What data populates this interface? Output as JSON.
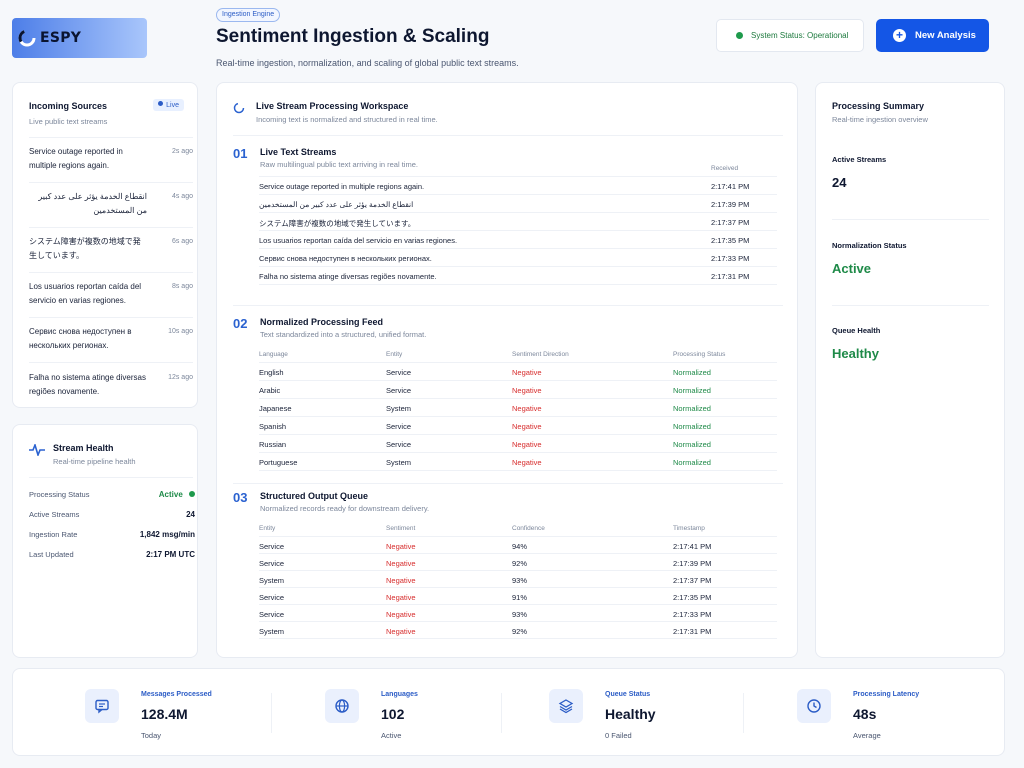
{
  "brand": {
    "name": "ESPY"
  },
  "header": {
    "tag": "Ingestion Engine",
    "title": "Sentiment Ingestion & Scaling",
    "subtitle": "Real-time ingestion, normalization, and scaling of global public text streams.",
    "status": "System Status: Operational",
    "new_button": "New Analysis"
  },
  "sources": {
    "title": "Incoming Sources",
    "subtitle": "Live public text streams",
    "badge": "Live",
    "items": [
      {
        "text": "Service outage reported in multiple regions again.",
        "time": "2s ago"
      },
      {
        "text": "انقطاع الخدمة يؤثر على عدد كبير من المستخدمين",
        "time": "4s ago"
      },
      {
        "text": "システム障害が複数の地域で発生しています。",
        "time": "6s ago"
      },
      {
        "text": "Los usuarios reportan caída del servicio en varias regiones.",
        "time": "8s ago"
      },
      {
        "text": "Сервис снова недоступен в нескольких регионах.",
        "time": "10s ago"
      },
      {
        "text": "Falha no sistema atinge diversas regiões novamente.",
        "time": "12s ago"
      }
    ]
  },
  "health": {
    "title": "Stream Health",
    "subtitle": "Real-time pipeline health",
    "rows": [
      {
        "label": "Processing Status",
        "value": "Active"
      },
      {
        "label": "Active Streams",
        "value": "24"
      },
      {
        "label": "Ingestion Rate",
        "value": "1,842 msg/min"
      },
      {
        "label": "Last Updated",
        "value": "2:17 PM UTC"
      }
    ]
  },
  "workspace": {
    "title": "Live Stream Processing Workspace",
    "subtitle": "Incoming text is normalized and structured in real time.",
    "s1": {
      "num": "01",
      "title": "Live Text Streams",
      "subtitle": "Raw multilingual public text arriving in real time.",
      "col_received": "Received",
      "rows": [
        {
          "text": "Service outage reported in multiple regions again.",
          "time": "2:17:41 PM"
        },
        {
          "text": "انقطاع الخدمة يؤثر على عدد كبير من المستخدمين",
          "time": "2:17:39 PM"
        },
        {
          "text": "システム障害が複数の地域で発生しています。",
          "time": "2:17:37 PM"
        },
        {
          "text": "Los usuarios reportan caída del servicio en varias regiones.",
          "time": "2:17:35 PM"
        },
        {
          "text": "Сервис снова недоступен в нескольких регионах.",
          "time": "2:17:33 PM"
        },
        {
          "text": "Falha no sistema atinge diversas regiões novamente.",
          "time": "2:17:31 PM"
        }
      ]
    },
    "s2": {
      "num": "02",
      "title": "Normalized Processing Feed",
      "subtitle": "Text standardized into a structured, unified format.",
      "cols": [
        "Language",
        "Entity",
        "Sentiment Direction",
        "Processing Status"
      ],
      "rows": [
        [
          "English",
          "Service",
          "Negative",
          "Normalized"
        ],
        [
          "Arabic",
          "Service",
          "Negative",
          "Normalized"
        ],
        [
          "Japanese",
          "System",
          "Negative",
          "Normalized"
        ],
        [
          "Spanish",
          "Service",
          "Negative",
          "Normalized"
        ],
        [
          "Russian",
          "Service",
          "Negative",
          "Normalized"
        ],
        [
          "Portuguese",
          "System",
          "Negative",
          "Normalized"
        ]
      ]
    },
    "s3": {
      "num": "03",
      "title": "Structured Output Queue",
      "subtitle": "Normalized records ready for downstream delivery.",
      "cols": [
        "Entity",
        "Sentiment",
        "Confidence",
        "Timestamp"
      ],
      "rows": [
        [
          "Service",
          "Negative",
          "94%",
          "2:17:41 PM"
        ],
        [
          "Service",
          "Negative",
          "92%",
          "2:17:39 PM"
        ],
        [
          "System",
          "Negative",
          "93%",
          "2:17:37 PM"
        ],
        [
          "Service",
          "Negative",
          "91%",
          "2:17:35 PM"
        ],
        [
          "Service",
          "Negative",
          "93%",
          "2:17:33 PM"
        ],
        [
          "System",
          "Negative",
          "92%",
          "2:17:31 PM"
        ]
      ]
    }
  },
  "summary": {
    "title": "Processing Summary",
    "subtitle": "Real-time ingestion overview",
    "items": [
      {
        "label": "Active Streams",
        "value": "24"
      },
      {
        "label": "Normalization Status",
        "value": "Active"
      },
      {
        "label": "Queue Health",
        "value": "Healthy"
      }
    ]
  },
  "stats": [
    {
      "label": "Messages Processed",
      "value": "128.4M",
      "sub": "Today",
      "icon": "message-icon"
    },
    {
      "label": "Languages",
      "value": "102",
      "sub": "Active",
      "icon": "globe-icon"
    },
    {
      "label": "Queue Status",
      "value": "Healthy",
      "sub": "0 Failed",
      "icon": "layers-icon"
    },
    {
      "label": "Processing Latency",
      "value": "48s",
      "sub": "Average",
      "icon": "clock-icon"
    }
  ],
  "colors": {
    "accent": "#1456e6",
    "negative": "#d72e2e",
    "positive": "#1e8a48"
  }
}
